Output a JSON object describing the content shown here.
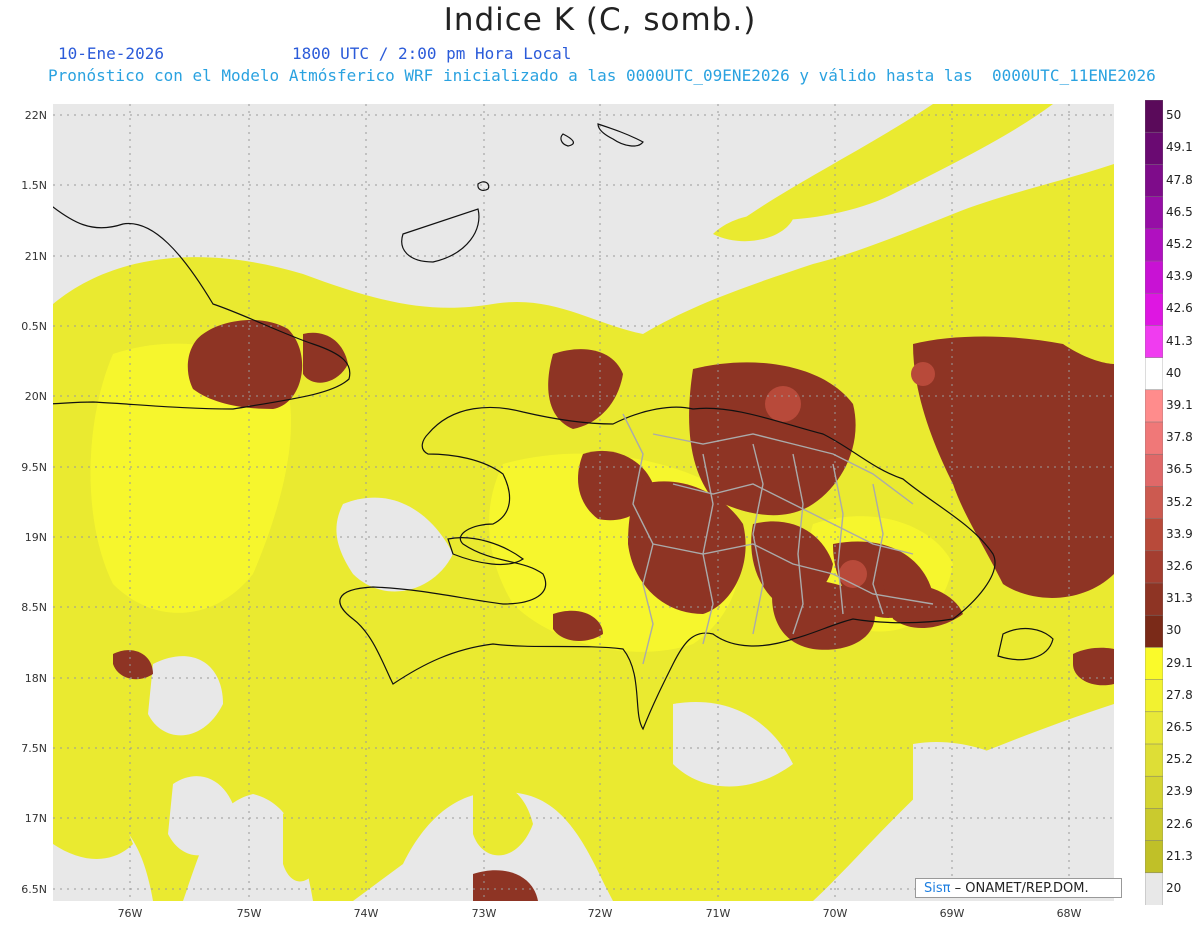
{
  "title": "Indice K (C, somb.)",
  "date": "10-Ene-2026",
  "time": "1800 UTC / 2:00 pm Hora Local",
  "forecast": "Pronóstico con el Modelo Atmósferico WRF inicializado a las 0000UTC_09ENE2026 y válido hasta las  0000UTC_11ENE2026",
  "lat_labels": [
    "22N",
    "1.5N",
    "21N",
    "0.5N",
    "20N",
    "9.5N",
    "19N",
    "8.5N",
    "18N",
    "7.5N",
    "17N",
    "6.5N"
  ],
  "lon_labels": [
    "76W",
    "75W",
    "74W",
    "73W",
    "72W",
    "71W",
    "70W",
    "69W",
    "68W"
  ],
  "colorbar": {
    "labels": [
      "50",
      "49.1",
      "47.8",
      "46.5",
      "45.2",
      "43.9",
      "42.6",
      "41.3",
      "40",
      "39.1",
      "37.8",
      "36.5",
      "35.2",
      "33.9",
      "32.6",
      "31.3",
      "30",
      "29.1",
      "27.8",
      "26.5",
      "25.2",
      "23.9",
      "22.6",
      "21.3",
      "20"
    ],
    "colors": [
      "#5a0a5a",
      "#6a0a72",
      "#7e0c8a",
      "#960ea6",
      "#b010c0",
      "#c812d4",
      "#de16e2",
      "#f03cf0",
      "#ffffff",
      "#ff8c8c",
      "#f07878",
      "#e06868",
      "#cc5a50",
      "#b84a3a",
      "#a43e30",
      "#8e3424",
      "#7a2a18",
      "#fafa2a",
      "#f2f230",
      "#e8e838",
      "#dede36",
      "#d4d432",
      "#caca2e",
      "#c0c028",
      "#e8e8e8"
    ]
  },
  "credit": {
    "sis": "Sisπ",
    "org": " – ONAMET/REP.DOM."
  }
}
